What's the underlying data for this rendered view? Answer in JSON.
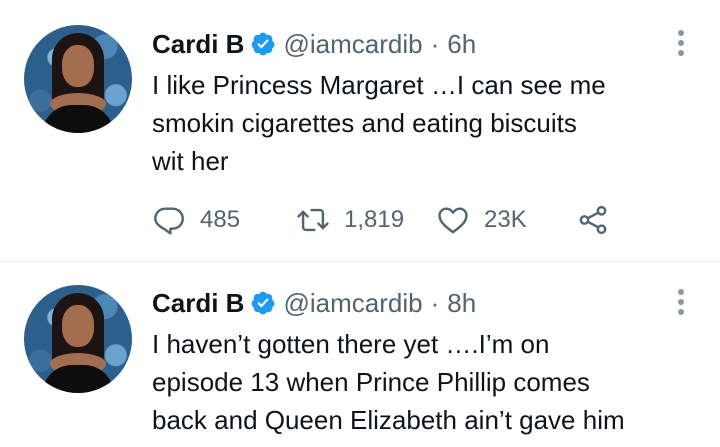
{
  "tweets": [
    {
      "name": "Cardi B",
      "handle": "@iamcardib",
      "separator": "·",
      "time": "6h",
      "text": "I like Princess Margaret …I can see me\nsmokin cigarettes and eating biscuits\nwit her",
      "replies": "485",
      "retweets": "1,819",
      "likes": "23K"
    },
    {
      "name": "Cardi B",
      "handle": "@iamcardib",
      "separator": "·",
      "time": "8h",
      "text": "I haven’t gotten there yet ….I’m on\nepisode 13 when Prince Phillip comes\nback and Queen Elizabeth ain’t gave him"
    }
  ],
  "icons": {
    "verified": "verified-badge-icon",
    "more": "more-vertical-icon",
    "reply": "reply-icon",
    "retweet": "retweet-icon",
    "like": "heart-icon",
    "share": "share-icon"
  },
  "colors": {
    "text": "#0f1419",
    "secondary": "#536471",
    "verified": "#1d9bf0",
    "separator": "#e6ecf0"
  }
}
